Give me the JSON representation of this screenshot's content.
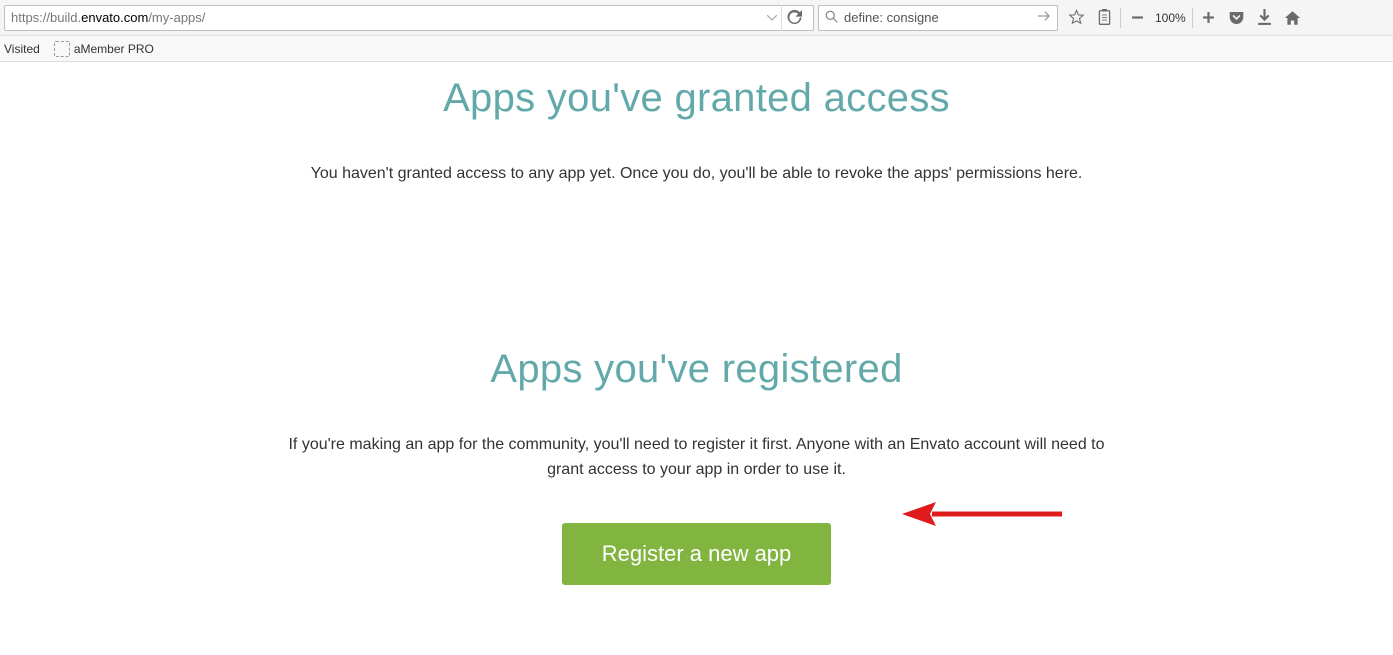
{
  "browser": {
    "url_prefix": "https://build.",
    "url_domain": "envato.com",
    "url_suffix": "/my-apps/",
    "search_value": "define: consigne",
    "zoom": "100%"
  },
  "bookmarks": {
    "visited_label": "Visited",
    "item1_label": "aMember PRO"
  },
  "sections": {
    "granted": {
      "title": "Apps you've granted access",
      "text": "You haven't granted access to any app yet. Once you do, you'll be able to revoke the apps' permissions here."
    },
    "registered": {
      "title": "Apps you've registered",
      "text": "If you're making an app for the community, you'll need to register it first. Anyone with an Envato account will need to grant access to your app in order to use it.",
      "button_label": "Register a new app"
    }
  }
}
